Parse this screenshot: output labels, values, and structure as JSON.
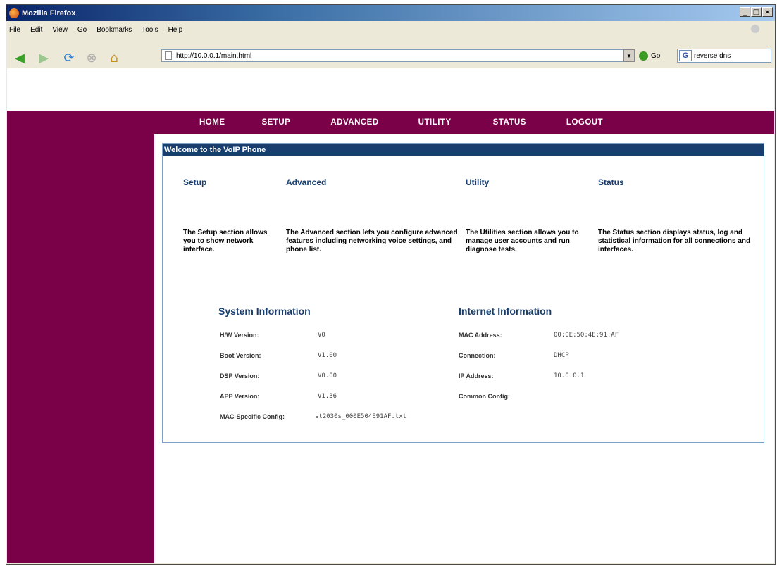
{
  "window": {
    "title": "Mozilla Firefox"
  },
  "menu": {
    "items": [
      "File",
      "Edit",
      "View",
      "Go",
      "Bookmarks",
      "Tools",
      "Help"
    ]
  },
  "toolbar": {
    "url": "http://10.0.0.1/main.html",
    "go_label": "Go",
    "search_value": "reverse dns"
  },
  "nav": {
    "links": [
      "HOME",
      "SETUP",
      "ADVANCED",
      "UTILITY",
      "STATUS",
      "LOGOUT"
    ]
  },
  "welcome": {
    "header": "Welcome to the VoIP Phone",
    "sections": [
      {
        "title": "Setup",
        "description": "The Setup section allows you to show network interface."
      },
      {
        "title": "Advanced",
        "description": "The Advanced section lets you configure advanced features including networking voice settings, and phone list."
      },
      {
        "title": "Utility",
        "description": "The Utilities section allows you to manage user accounts and run diagnose tests."
      },
      {
        "title": "Status",
        "description": "The Status section displays status, log and statistical information for all connections and interfaces."
      }
    ]
  },
  "system_info": {
    "title": "System Information",
    "rows": [
      {
        "label": "H/W Version:",
        "value": "V0"
      },
      {
        "label": "Boot Version:",
        "value": "V1.00"
      },
      {
        "label": "DSP Version:",
        "value": "V0.00"
      },
      {
        "label": "APP Version:",
        "value": "V1.36"
      },
      {
        "label": "MAC-Specific Config:",
        "value": "st2030s_000E504E91AF.txt"
      }
    ]
  },
  "internet_info": {
    "title": "Internet Information",
    "rows": [
      {
        "label": "MAC Address:",
        "value": "00:0E:50:4E:91:AF"
      },
      {
        "label": "Connection:",
        "value": "DHCP"
      },
      {
        "label": "IP Address:",
        "value": "10.0.0.1"
      },
      {
        "label": "Common Config:",
        "value": ""
      }
    ]
  }
}
